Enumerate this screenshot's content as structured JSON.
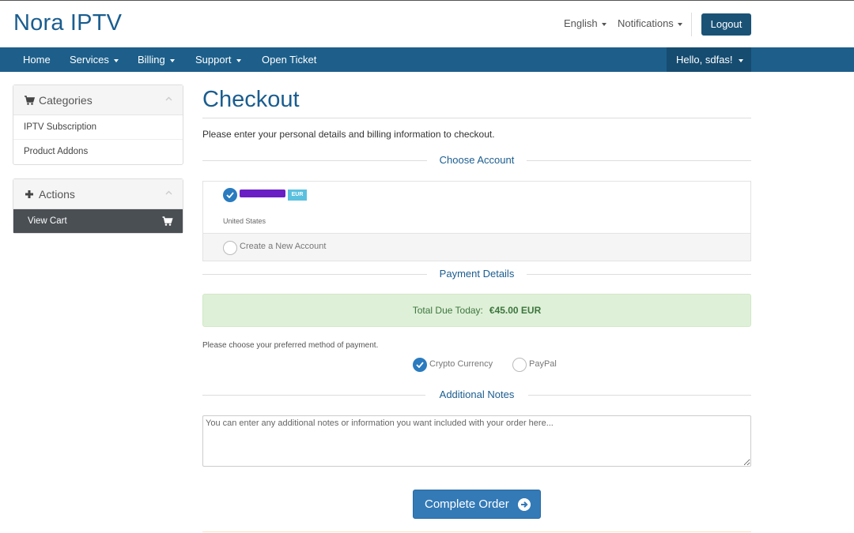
{
  "header": {
    "brand": "Nora IPTV",
    "language": "English",
    "notifications": "Notifications",
    "logout": "Logout"
  },
  "nav": {
    "items": [
      {
        "label": "Home",
        "dropdown": false
      },
      {
        "label": "Services",
        "dropdown": true
      },
      {
        "label": "Billing",
        "dropdown": true
      },
      {
        "label": "Support",
        "dropdown": true
      },
      {
        "label": "Open Ticket",
        "dropdown": false
      }
    ],
    "user": "Hello, sdfas!"
  },
  "sidebar": {
    "categories": {
      "title": "Categories",
      "icon": "cart-icon",
      "items": [
        "IPTV Subscription",
        "Product Addons"
      ]
    },
    "actions": {
      "title": "Actions",
      "icon": "plus-icon",
      "view_cart": "View Cart"
    }
  },
  "main": {
    "title": "Checkout",
    "intro": "Please enter your personal details and billing information to checkout.",
    "choose_account": {
      "heading": "Choose Account",
      "existing": {
        "currency_badge": "EUR",
        "country": "United States",
        "selected": true
      },
      "new_account": "Create a New Account"
    },
    "payment": {
      "heading": "Payment Details",
      "total_label": "Total Due Today:",
      "total_value": "€45.00 EUR",
      "method_prompt": "Please choose your preferred method of payment.",
      "methods": [
        {
          "label": "Crypto Currency",
          "selected": true
        },
        {
          "label": "PayPal",
          "selected": false
        }
      ]
    },
    "notes": {
      "heading": "Additional Notes",
      "placeholder": "You can enter any additional notes or information you want included with your order here..."
    },
    "complete_button": "Complete Order"
  },
  "colors": {
    "brand": "#1a5d8f",
    "navbar": "#1d5f8a",
    "primary_button": "#337ab7",
    "success_bg": "#dff0d8",
    "badge": "#5bc0de"
  }
}
